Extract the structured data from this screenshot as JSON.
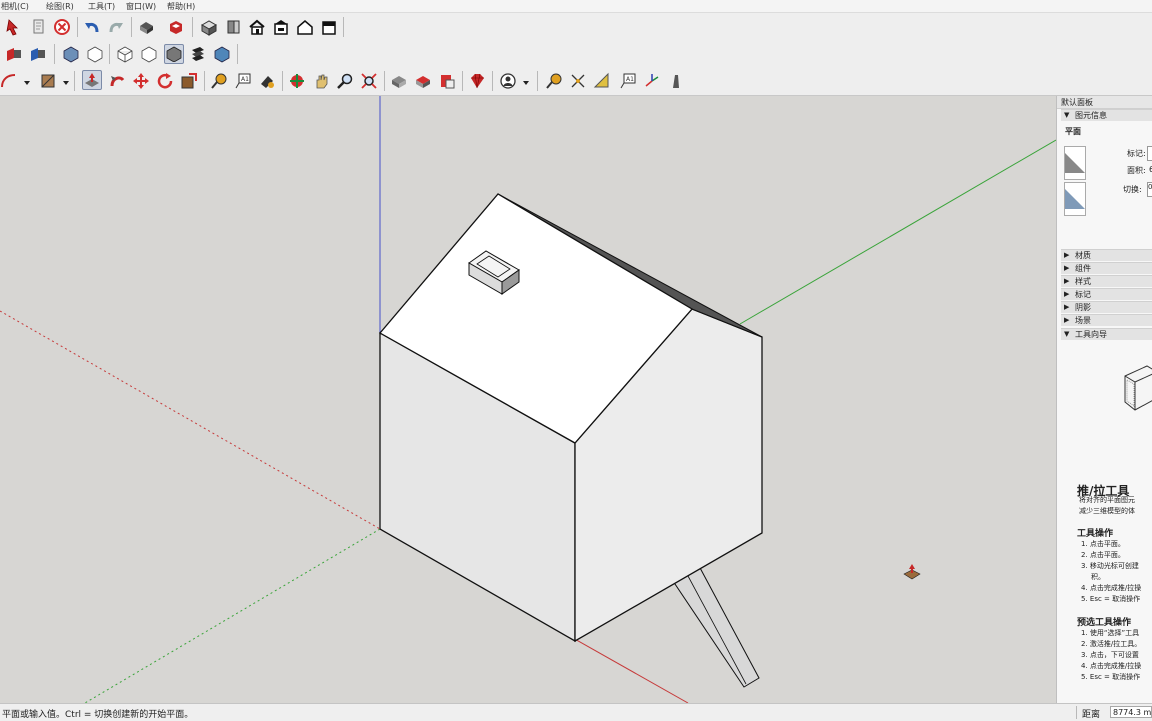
{
  "menu": {
    "items": [
      "相机(C)",
      "绘图(R)",
      "工具(T)",
      "窗口(W)",
      "帮助(H)"
    ]
  },
  "toolbar": {
    "row1_icons": [
      "select-pointer-icon",
      "model-info-icon",
      "erase-cancel-icon",
      "undo-icon",
      "redo-icon",
      "print-icon",
      "extension-icon",
      "iso-view-icon",
      "front-view-icon",
      "home-view-icon",
      "house-top-view-icon",
      "house-outline-view-icon",
      "warehouse-view-icon"
    ],
    "row2_icons": [
      "section-plane-icon",
      "section-display-icon",
      "xray-icon",
      "wireframe-icon",
      "hidden-line-icon",
      "shaded-icon",
      "textured-icon",
      "monochrome-icon"
    ],
    "row3_icons": [
      "arc-icon",
      "paint-bucket-icon",
      "push-pull-icon",
      "follow-me-icon",
      "move-icon",
      "rotate-icon",
      "scale-icon",
      "tape-measure-icon",
      "text-icon",
      "paint-icon",
      "orbit-icon",
      "pan-icon",
      "zoom-icon",
      "zoom-extents-icon",
      "geo-location-icon",
      "3d-warehouse-icon",
      "extension-warehouse-icon",
      "ruby-icon",
      "user-icon",
      "tape-icon",
      "dimension-icon",
      "protractor-icon",
      "3d-text-icon",
      "axes-icon",
      "walk-icon"
    ]
  },
  "viewport": {
    "colors": {
      "background": "#d7d6d3",
      "red_axis": "#c63a3a",
      "green_axis": "#3aa43a",
      "blue_axis": "#4450c8"
    }
  },
  "tray": {
    "title": "默认面板",
    "entity_info": {
      "header": "图元信息",
      "entity": "平面",
      "tag_label": "标记:",
      "area_label": "面积:",
      "area_value": "6",
      "toggle_label": "切换:",
      "toggle_value": "0"
    },
    "panels": [
      "材质",
      "组件",
      "样式",
      "标记",
      "阴影",
      "场景"
    ],
    "instructor": {
      "header": "工具向导",
      "tool_title": "推/拉工具",
      "desc_lines": [
        "将对齐的平面图元",
        "减少三维模型的体"
      ],
      "section1_title": "工具操作",
      "section1_items": [
        "1. 点击平面。",
        "2. 点击平面。",
        "3. 移动光标可创建",
        "积。",
        "4. 点击完成推/拉操",
        "5. Esc = 取消操作"
      ],
      "section2_title": "预选工具操作",
      "section2_items": [
        "1. 使用“选择”工具",
        "2. 激活推/拉工具。",
        "3. 点击，下可设置",
        "4. 点击完成推/拉操",
        "5. Esc = 取消操作"
      ]
    }
  },
  "status_bar": {
    "message": "平面或输入值。Ctrl = 切换创建新的开始平面。",
    "measurement_label": "距离",
    "measurement_value": "8774.3 m"
  }
}
